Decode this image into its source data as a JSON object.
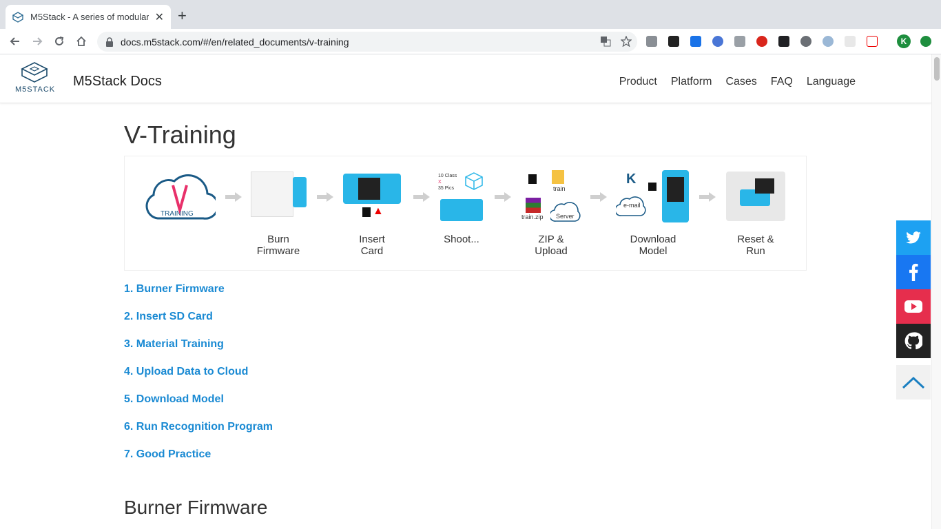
{
  "browser": {
    "tab_title": "M5Stack - A series of modular",
    "url": "docs.m5stack.com/#/en/related_documents/v-training"
  },
  "site": {
    "logo_text": "M5STACK",
    "title": "M5Stack Docs",
    "nav": [
      "Product",
      "Platform",
      "Cases",
      "FAQ",
      "Language"
    ]
  },
  "page": {
    "title": "V-Training",
    "diagram": {
      "training_label": "TRAINING",
      "shoot_text_1": "10 Class",
      "shoot_text_2": "35 Pics",
      "zip_train": "train",
      "zip_file": "train.zip",
      "server": "Server",
      "email": "e-mail",
      "steps": [
        {
          "line1": "Burn",
          "line2": "Firmware"
        },
        {
          "line1": "Insert",
          "line2": "Card"
        },
        {
          "line1": "Shoot...",
          "line2": ""
        },
        {
          "line1": "ZIP &",
          "line2": "Upload"
        },
        {
          "line1": "Download",
          "line2": "Model"
        },
        {
          "line1": "Reset &",
          "line2": "Run"
        }
      ]
    },
    "toc": [
      "1. Burner Firmware",
      "2. Insert SD Card",
      "3. Material Training",
      "4. Upload Data to Cloud",
      "5. Download Model",
      "6. Run Recognition Program",
      "7. Good Practice"
    ],
    "section_title": "Burner Firmware"
  },
  "colors": {
    "link": "#1a8ad3",
    "twitter": "#1da1f2",
    "facebook": "#1877f2",
    "youtube": "#e62e4d",
    "github": "#222222",
    "accent_blue": "#29b6e8"
  },
  "avatar_letter": "K"
}
